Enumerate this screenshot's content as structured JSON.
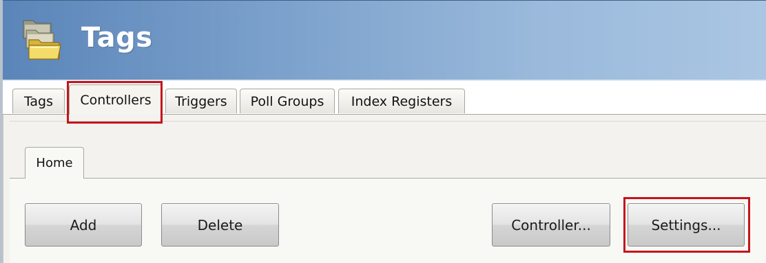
{
  "header": {
    "title": "Tags",
    "icon": "folder-stack-icon"
  },
  "tabs": [
    {
      "label": "Tags",
      "active": false
    },
    {
      "label": "Controllers",
      "active": true
    },
    {
      "label": "Triggers",
      "active": false
    },
    {
      "label": "Poll Groups",
      "active": false
    },
    {
      "label": "Index Registers",
      "active": false
    }
  ],
  "subtabs": [
    {
      "label": "Home",
      "active": true
    }
  ],
  "toolbar": {
    "add_label": "Add",
    "delete_label": "Delete",
    "controller_label": "Controller...",
    "settings_label": "Settings..."
  },
  "colors": {
    "header_gradient_start": "#5b85b9",
    "header_gradient_end": "#aac6e3",
    "highlight": "#c4141b",
    "content_bg": "#f3f2ee"
  }
}
